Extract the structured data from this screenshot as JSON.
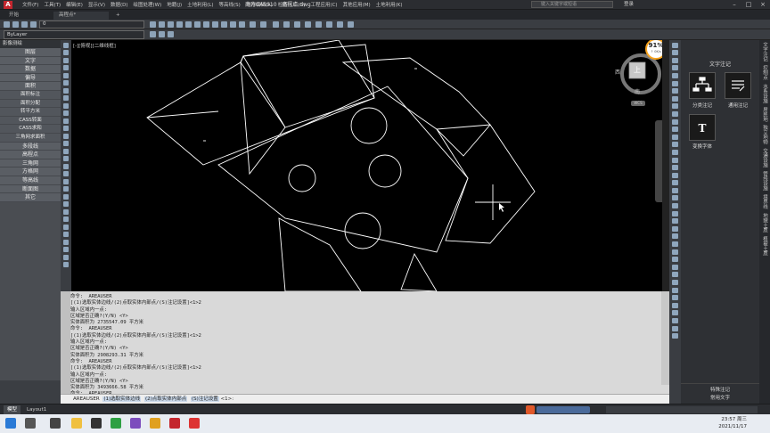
{
  "title": {
    "app_name": "南方CASS10",
    "file_name": "高程点.dwg",
    "search_placeholder": "键入关键字或短语",
    "login_label": "登录",
    "menu": [
      "文件(F)",
      "工具(T)",
      "编辑(E)",
      "显示(V)",
      "数据(D)",
      "绘图处理(W)",
      "地籍(J)",
      "土地利用(L)",
      "等高线(S)",
      "地物编辑(A)",
      "检查入库(G)",
      "工程应用(C)",
      "其他应用(M)",
      "土地利用(K)"
    ]
  },
  "tabs": {
    "start": "开始",
    "drawing": "高程点*",
    "add": "+"
  },
  "toolbar": {
    "layer_combo": "0",
    "color_combo": "ByLayer"
  },
  "side_panel": {
    "title": "影像测绘",
    "items": [
      "图层",
      "文字",
      "数据",
      "偏导",
      "面积"
    ],
    "sub_items": [
      "面积标注",
      "面积分配",
      "转平方米",
      "CASS转面",
      "CASS求和",
      "三角网求面积"
    ],
    "items2": [
      "多段线",
      "高程点",
      "三角网",
      "方格网",
      "等高线",
      "断面图",
      "其它"
    ]
  },
  "viewport": {
    "label": "[-][俯视][二维线框]"
  },
  "navcube": {
    "zoom_percent": "91%",
    "zoom_sub": "↑ 0K/s",
    "top_face": "上",
    "west": "西",
    "east": "东",
    "south": "南",
    "ucs": "WCS"
  },
  "command_history": [
    "命令:  AREAUSER",
    "[(1)选取实体边线/(2)点取实体内部点/(S)注记设置]<1>2",
    "输入区域内一点:",
    "区域是否正确?(Y/N) <Y>",
    "实体面积为 2735547.09 平方米",
    "命令:  AREAUSER",
    "[(1)选取实体边线/(2)点取实体内部点/(S)注记设置]<1>2",
    "输入区域内一点:",
    "区域是否正确?(Y/N) <Y>",
    "实体面积为 2908293.31 平方米",
    "命令:  AREAUSER",
    "[(1)选取实体边线/(2)点取实体内部点/(S)注记设置]<1>2",
    "输入区域内一点:",
    "区域是否正确?(Y/N) <Y>",
    "实体面积为 3493666.58 平方米",
    "命令:  AREAUSER"
  ],
  "command_input": {
    "command": "AREAUSER",
    "options": [
      "(1)选取实体边线",
      "(2)点取实体内部点",
      "(S)注记设置"
    ],
    "suffix": "<1>:"
  },
  "right_panel": {
    "title": "文字注记",
    "tools": [
      "分类注记",
      "通用注记",
      "变换字体"
    ],
    "footer1": "特殊注记",
    "footer2": "常用文字",
    "tabs": [
      "文字注记",
      "控制点",
      "水系设施",
      "居民地",
      "独立地物",
      "交通设施",
      "管线设施",
      "境界线",
      "地貌土质",
      "植被土质"
    ]
  },
  "layout_tabs": {
    "model": "模型",
    "layout1": "Layout1"
  },
  "clock": {
    "time": "23:57 周三",
    "date": "2021/11/17"
  },
  "colors": {
    "accent": "#c4262e",
    "drawing_bg": "#000000",
    "line": "#ffffff"
  }
}
